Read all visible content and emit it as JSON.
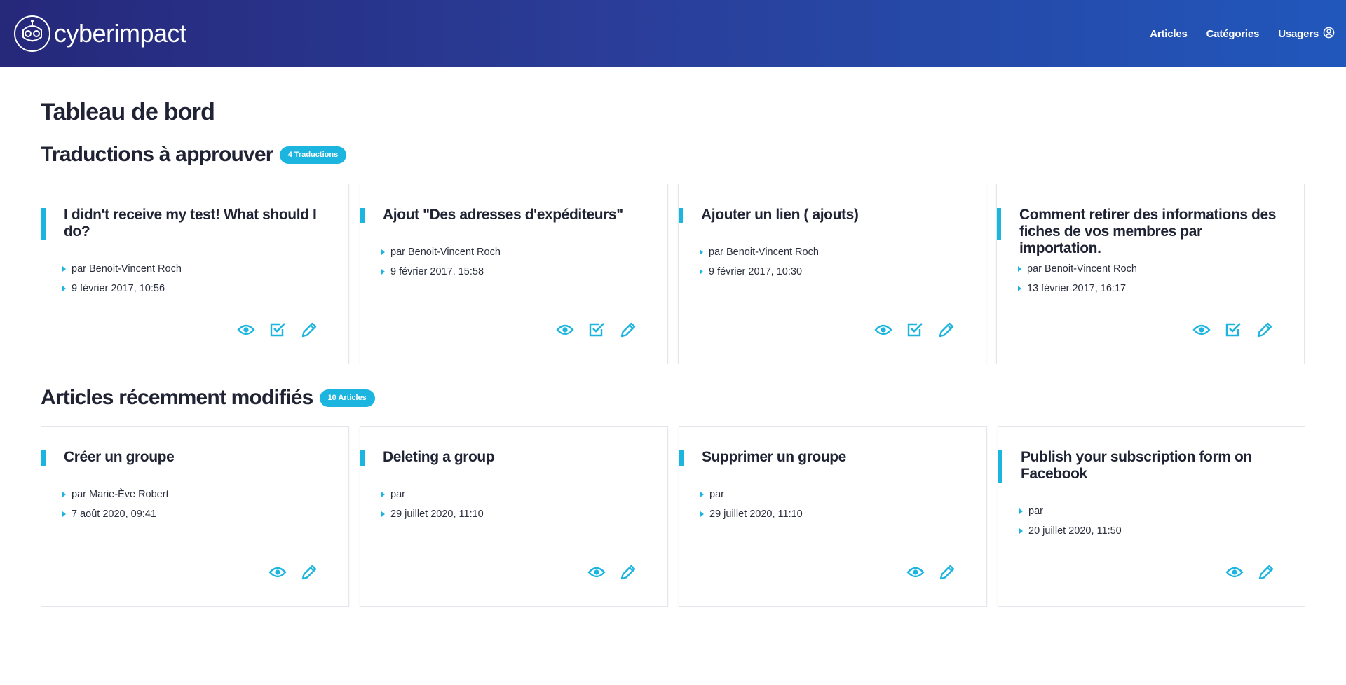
{
  "header": {
    "brand_name": "cyberimpact",
    "nav": [
      {
        "label": "Articles"
      },
      {
        "label": "Catégories"
      },
      {
        "label": "Usagers"
      }
    ]
  },
  "page_title": "Tableau de bord",
  "sections": [
    {
      "title": "Traductions à approuver",
      "badge": "4 Traductions",
      "cards": [
        {
          "title": "I didn't receive my test! What should I do?",
          "author": "par Benoit-Vincent Roch",
          "date": "9 février 2017, 10:56"
        },
        {
          "title": "Ajout \"Des adresses d'expéditeurs\"",
          "author": "par Benoit-Vincent Roch",
          "date": "9 février 2017, 15:58"
        },
        {
          "title": "Ajouter un lien ( ajouts)",
          "author": "par Benoit-Vincent Roch",
          "date": "9 février 2017, 10:30"
        },
        {
          "title": "Comment retirer des informations des fiches de vos membres par importation.",
          "author": "par Benoit-Vincent Roch",
          "date": "13 février 2017, 16:17"
        }
      ]
    },
    {
      "title": "Articles récemment modifiés",
      "badge": "10 Articles",
      "cards": [
        {
          "title": "Créer un groupe",
          "author": "par Marie-Ève Robert",
          "date": "7 août 2020, 09:41"
        },
        {
          "title": "Deleting a group",
          "author": "par",
          "date": "29 juillet 2020, 11:10"
        },
        {
          "title": "Supprimer un groupe",
          "author": "par",
          "date": "29 juillet 2020, 11:10"
        },
        {
          "title": "Publish your subscription form on Facebook",
          "author": "par",
          "date": "20 juillet 2020, 11:50"
        }
      ]
    }
  ],
  "colors": {
    "accent": "#1cb5e0",
    "header_start": "#26287a",
    "header_end": "#2157bb",
    "text": "#1f2333"
  },
  "icons": {
    "logo": "robot-mascot-icon",
    "user": "user-circle-icon",
    "view": "eye-icon",
    "approve": "checkbox-approve-icon",
    "edit": "pencil-icon"
  }
}
